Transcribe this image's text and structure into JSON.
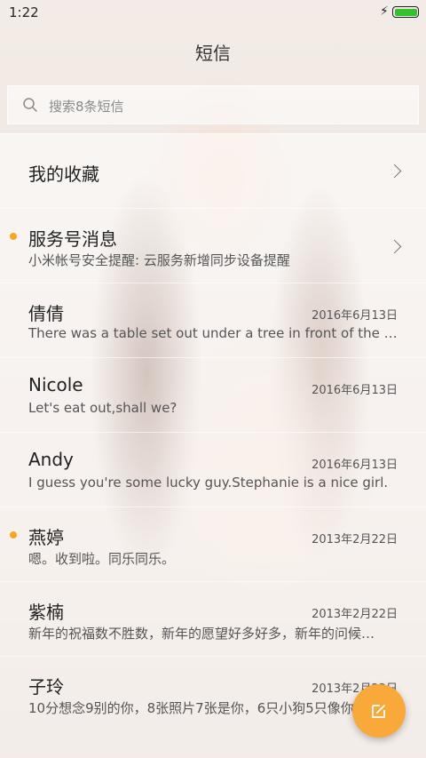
{
  "status": {
    "time": "1:22",
    "battery_color": "#35c02e"
  },
  "header": {
    "title": "短信"
  },
  "search": {
    "placeholder": "搜索8条短信"
  },
  "rows": [
    {
      "name": "我的收藏",
      "snippet": "",
      "date": "",
      "unread": false,
      "chevron": true
    },
    {
      "name": "服务号消息",
      "snippet": "小米帐号安全提醒: 云服务新增同步设备提醒",
      "date": "",
      "unread": true,
      "chevron": true
    },
    {
      "name": "倩倩",
      "snippet": "There was a table set out under a tree in front of the house…",
      "date": "2016年6月13日",
      "unread": false
    },
    {
      "name": "Nicole",
      "snippet": "Let's eat out,shall we?",
      "date": "2016年6月13日",
      "unread": false
    },
    {
      "name": "Andy",
      "snippet": "I guess you're some lucky guy.Stephanie is a nice girl.",
      "date": "2016年6月13日",
      "unread": false
    },
    {
      "name": "燕婷",
      "snippet": "嗯。收到啦。同乐同乐。",
      "date": "2013年2月22日",
      "unread": true
    },
    {
      "name": "紫楠",
      "snippet": "新年的祝福数不胜数，新年的愿望好多好多，新年的问候…",
      "date": "2013年2月22日",
      "unread": false
    },
    {
      "name": "子玲",
      "snippet": "10分想念9别的你，8张照片7张是你，6只小狗5只像你…",
      "date": "2013年2月22日",
      "unread": false
    }
  ],
  "fab": {
    "icon": "compose-icon",
    "color": "#f8a93a"
  }
}
